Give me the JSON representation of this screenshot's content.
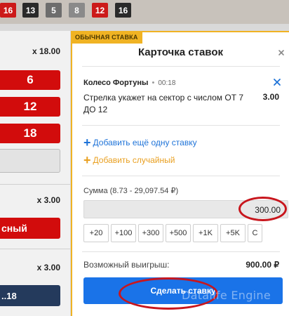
{
  "history": [
    {
      "value": "16",
      "color": "#cc1a1a"
    },
    {
      "value": "13",
      "color": "#2a2a2a"
    },
    {
      "value": "5",
      "color": "#6d6d6d"
    },
    {
      "value": "8",
      "color": "#8a8a8a"
    },
    {
      "value": "12",
      "color": "#cc1a1a"
    },
    {
      "value": "16",
      "color": "#2a2a2a"
    }
  ],
  "left": {
    "mult_1": "x 18.00",
    "numbers": [
      "6",
      "12",
      "18"
    ],
    "mult_2": "x 3.00",
    "red_text": "сный",
    "mult_3": "x 3.00",
    "navy_text": "..18"
  },
  "slip": {
    "tag": "ОБЫЧНАЯ СТАВКА",
    "title": "Карточка ставок",
    "event_name": "Колесо Фортуны",
    "event_sep": "•",
    "event_time": "00:18",
    "outcome": "Стрелка укажет на сектор с числом ОТ 7 ДО 12",
    "odds": "3.00",
    "add_bet": "Добавить ещё одну ставку",
    "add_random": "Добавить случайный",
    "amount_label": "Сумма (8.73 - 29,097.54 ₽)",
    "amount_value": "300.00",
    "quick": [
      "+20",
      "+100",
      "+300",
      "+500",
      "+1K",
      "+5K",
      "C"
    ],
    "win_label": "Возможный выигрыш:",
    "win_value": "900.00 ₽",
    "submit": "Сделать ставку",
    "watermark": "Datalife Engine"
  },
  "colors": {
    "accent_blue": "#1a73e8",
    "accent_orange": "#f0b323",
    "annotation_red": "#c8161d",
    "number_red": "#d20c0c"
  }
}
